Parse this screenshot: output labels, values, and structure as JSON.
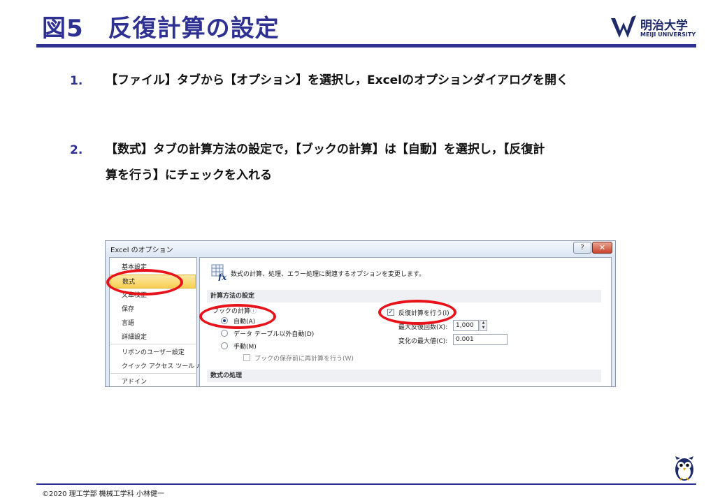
{
  "slide": {
    "title": "図5　反復計算の設定",
    "logo_name": "明治大学",
    "logo_sub": "MEIJI UNIVERSITY"
  },
  "steps": [
    {
      "number": "1.",
      "text": "【ファイル】タブから【オプション】を選択し，Excelのオプションダイアログを開く"
    },
    {
      "number": "2.",
      "text": "【数式】タブの計算方法の設定で，【ブックの計算】は【自動】を選択し，【反復計算を行う】にチェックを入れる"
    }
  ],
  "dialog": {
    "title": "Excel のオプション",
    "help_label": "?",
    "close_label": "✕",
    "nav": [
      {
        "label": "基本設定",
        "selected": false
      },
      {
        "label": "数式",
        "selected": true
      },
      {
        "label": "文章校正",
        "selected": false
      },
      {
        "label": "保存",
        "selected": false
      },
      {
        "label": "言語",
        "selected": false
      },
      {
        "label": "詳細設定",
        "selected": false
      },
      {
        "label": "リボンのユーザー設定",
        "selected": false
      },
      {
        "label": "クイック アクセス ツール バー",
        "selected": false
      },
      {
        "label": "アドイン",
        "selected": false
      }
    ],
    "intro": "数式の計算、処理、エラー処理に関連するオプションを変更します。",
    "section_calc": "計算方法の設定",
    "workbook_calc_label": "ブックの計算",
    "info_icon": "ⓘ",
    "radio_auto": "自動(A)",
    "radio_auto_except": "データ テーブル以外自動(D)",
    "radio_manual": "手動(M)",
    "recalc_before_save": "ブックの保存前に再計算を行う(W)",
    "iterative_label": "反復計算を行う(I)",
    "iterative_checked": true,
    "max_iter_label": "最大反復回数(X):",
    "max_iter_value": "1,000",
    "max_change_label": "変化の最大値(C):",
    "max_change_value": "0.001",
    "section_formula": "数式の処理",
    "colors": {
      "highlight": "#e8121a",
      "accent": "#2e3192"
    }
  },
  "footer": {
    "text": "©2020  理工学部  機械工学科  小林健一"
  }
}
